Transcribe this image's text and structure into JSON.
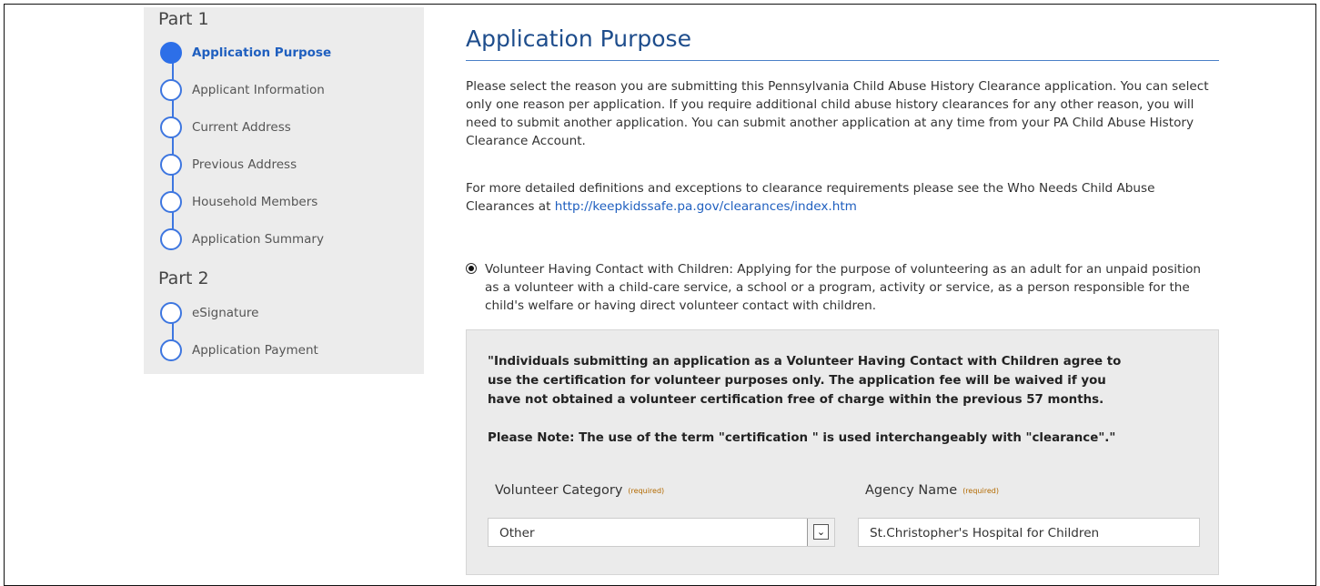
{
  "sidebar": {
    "part1_title": "Part 1",
    "part2_title": "Part 2",
    "part1_steps": [
      {
        "label": "Application Purpose",
        "active": true
      },
      {
        "label": "Applicant Information",
        "active": false
      },
      {
        "label": "Current Address",
        "active": false
      },
      {
        "label": "Previous Address",
        "active": false
      },
      {
        "label": "Household Members",
        "active": false
      },
      {
        "label": "Application Summary",
        "active": false
      }
    ],
    "part2_steps": [
      {
        "label": "eSignature",
        "active": false
      },
      {
        "label": "Application Payment",
        "active": false
      }
    ]
  },
  "main": {
    "title": "Application Purpose",
    "intro": "Please select the reason you are submitting this Pennsylvania Child Abuse History Clearance application. You can select only one reason per application. If you require additional child abuse history clearances for any other reason, you will need to submit another application. You can submit another application at any time from your PA Child Abuse History Clearance Account.",
    "definitions_text": "For more detailed definitions and exceptions to clearance requirements please see the Who Needs Child Abuse Clearances at",
    "definitions_link": "http://keepkidssafe.pa.gov/clearances/index.htm",
    "option_label": "Volunteer Having Contact with Children: Applying for the purpose of volunteering as an adult for an unpaid position as a volunteer with a child-care service, a school or a program, activity or service, as a person responsible for the child's welfare or having direct volunteer contact with children.",
    "option_selected": true,
    "notice": "\"Individuals submitting an application as a Volunteer Having Contact with Children agree to use the certification for volunteer purposes only. The application fee will be waived if you have not obtained a volunteer certification free of charge within the previous 57 months.",
    "note": "Please Note: The use of the term \"certification \" is used interchangeably with \"clearance\".\"",
    "volunteer_category_label": "Volunteer Category",
    "agency_name_label": "Agency Name",
    "required_tag": "(required)",
    "volunteer_category_value": "Other",
    "agency_name_value": "St.Christopher's Hospital for Children",
    "dropdown_icon": "chevron-down-icon"
  },
  "colors": {
    "accent": "#2d6fe8",
    "title": "#1e4d8c",
    "link": "#1f5fbf",
    "sidebar_bg": "#ececec",
    "required": "#b36a00"
  }
}
